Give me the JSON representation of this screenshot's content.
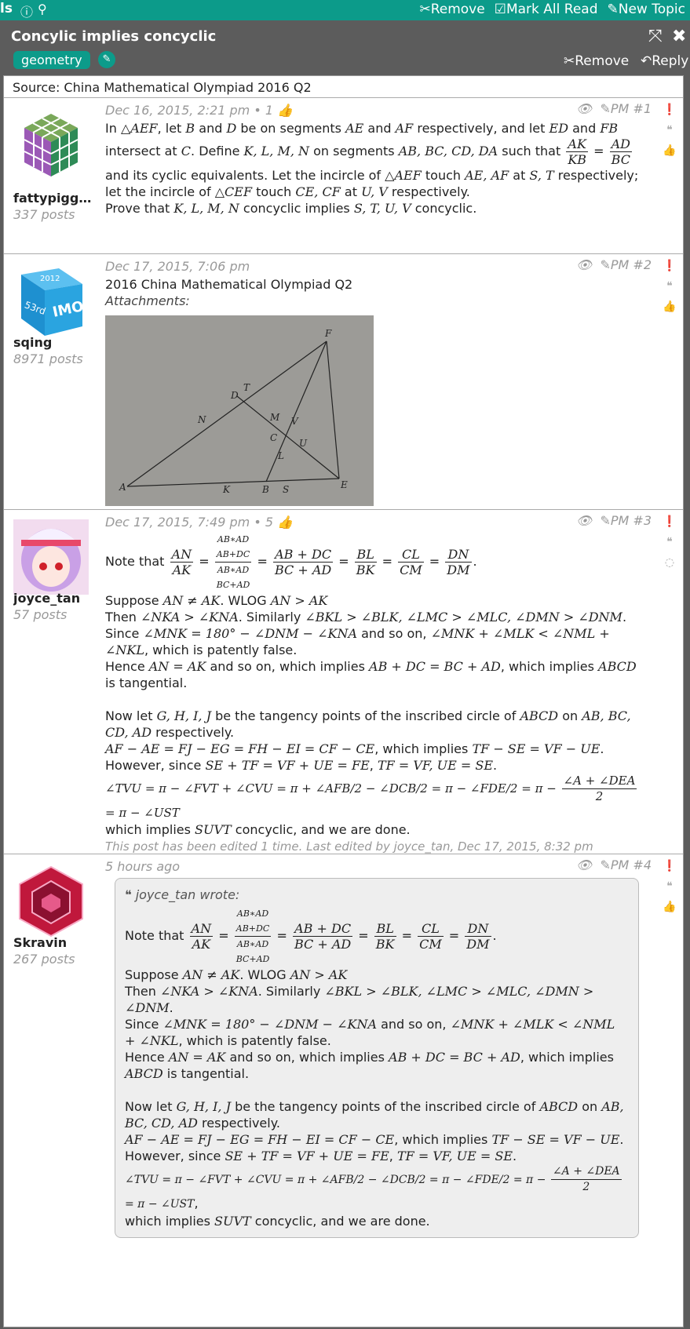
{
  "topbar": {
    "left_fragment": "ls",
    "info_icon": "info-icon",
    "search_icon": "search-icon",
    "remove_label": "Remove",
    "mark_read_label": "Mark All Read",
    "new_topic_label": "New Topic"
  },
  "topic": {
    "title": "Concylic implies concyclic",
    "tag": "geometry",
    "remove_label": "Remove",
    "reply_label": "Reply",
    "source": "Source: China Mathematical Olympiad 2016 Q2"
  },
  "posts": [
    {
      "username": "fattypiggy...",
      "post_count": "337 posts",
      "meta": "Dec 16, 2015, 2:21 pm • 1",
      "pm": "PM",
      "num": "#1"
    },
    {
      "username": "sqing",
      "post_count": "8971 posts",
      "meta": "Dec 17, 2015, 7:06 pm",
      "pm": "PM",
      "num": "#2",
      "text": "2016 China Mathematical Olympiad Q2",
      "attachments_label": "Attachments:"
    },
    {
      "username": "joyce_tan",
      "post_count": "57 posts",
      "meta": "Dec 17, 2015, 7:49 pm • 5",
      "pm": "PM",
      "num": "#3",
      "edited": "This post has been edited 1 time. Last edited by joyce_tan, Dec 17, 2015, 8:32 pm"
    },
    {
      "username": "Skravin",
      "post_count": "267 posts",
      "meta": "5 hours ago",
      "pm": "PM",
      "num": "#4",
      "quote_head": "joyce_tan wrote:"
    }
  ],
  "colors": {
    "accent": "#0c9b8a",
    "frame": "#5c5c5c"
  }
}
